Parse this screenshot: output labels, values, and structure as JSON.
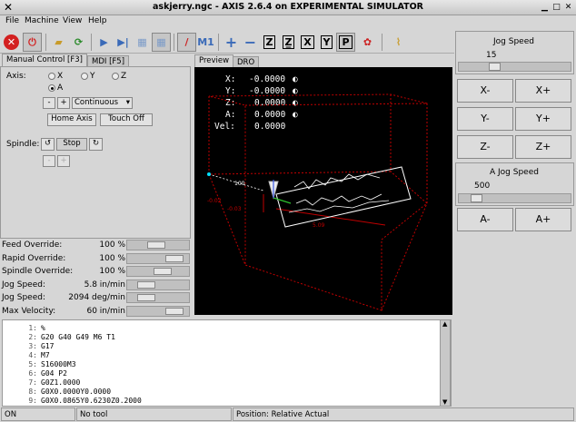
{
  "window": {
    "title": "askjerry.ngc - AXIS 2.6.4 on EXPERIMENTAL SIMULATOR"
  },
  "menu": {
    "file": "File",
    "machine": "Machine",
    "view": "View",
    "help": "Help"
  },
  "toolbar": {
    "estop_icon": "estop-icon",
    "power_icon": "power-icon",
    "x_btn": "X",
    "y_btn": "Y",
    "z_btn": "Z",
    "p_btn": "P"
  },
  "tabs": {
    "manual": "Manual Control [F3]",
    "mdi": "MDI [F5]",
    "preview": "Preview",
    "dro": "DRO"
  },
  "manual": {
    "axis_label": "Axis:",
    "axes": [
      "X",
      "Y",
      "Z",
      "A"
    ],
    "selected_axis": "A",
    "minus": "-",
    "plus": "+",
    "jog_mode": "Continuous",
    "home_axis": "Home Axis",
    "touch_off": "Touch Off",
    "spindle_label": "Spindle:",
    "spindle_stop": "Stop"
  },
  "overrides": [
    {
      "label": "Feed Override:",
      "value": "100 %",
      "level": 0.45
    },
    {
      "label": "Rapid Override:",
      "value": "100 %",
      "level": 0.88
    },
    {
      "label": "Spindle Override:",
      "value": "100 %",
      "level": 0.6
    },
    {
      "label": "Jog Speed:",
      "value": "5.8 in/min",
      "level": 0.22
    },
    {
      "label": "Jog Speed:",
      "value": "2094 deg/min",
      "level": 0.22
    },
    {
      "label": "Max Velocity:",
      "value": "60 in/min",
      "level": 0.88
    }
  ],
  "dro": [
    {
      "axis": "X:",
      "value": "-0.0000"
    },
    {
      "axis": "Y:",
      "value": "-0.0000"
    },
    {
      "axis": "Z:",
      "value": "0.0000"
    },
    {
      "axis": "A:",
      "value": "0.0000"
    },
    {
      "axis": "Vel:",
      "value": "0.0000"
    }
  ],
  "preview_labels": {
    "dim1": "100",
    "dim2": "-0.02",
    "dim3": "5.09",
    "dim4": "-0.03"
  },
  "jog": {
    "title": "Jog Speed",
    "speed": "15",
    "speed_level": 0.3,
    "x_minus": "X-",
    "x_plus": "X+",
    "y_minus": "Y-",
    "y_plus": "Y+",
    "z_minus": "Z-",
    "z_plus": "Z+",
    "a_title": "A Jog Speed",
    "a_speed": "500",
    "a_speed_level": 0.12,
    "a_minus": "A-",
    "a_plus": "A+"
  },
  "gcode": [
    {
      "n": "1:",
      "t": "%"
    },
    {
      "n": "2:",
      "t": "G20 G40 G49 M6 T1"
    },
    {
      "n": "3:",
      "t": "G17"
    },
    {
      "n": "4:",
      "t": "M7"
    },
    {
      "n": "5:",
      "t": "S16000M3"
    },
    {
      "n": "6:",
      "t": "G04 P2"
    },
    {
      "n": "7:",
      "t": "G0Z1.0000"
    },
    {
      "n": "8:",
      "t": "G0X0.0000Y0.0000"
    },
    {
      "n": "9:",
      "t": "G0X0.0865Y0.6230Z0.2000"
    }
  ],
  "status": {
    "state": "ON",
    "tool": "No tool",
    "position": "Position: Relative Actual"
  },
  "colors": {
    "preview_bg": "#000000",
    "limits": "#c00000",
    "toolpath": "#ffffff"
  }
}
